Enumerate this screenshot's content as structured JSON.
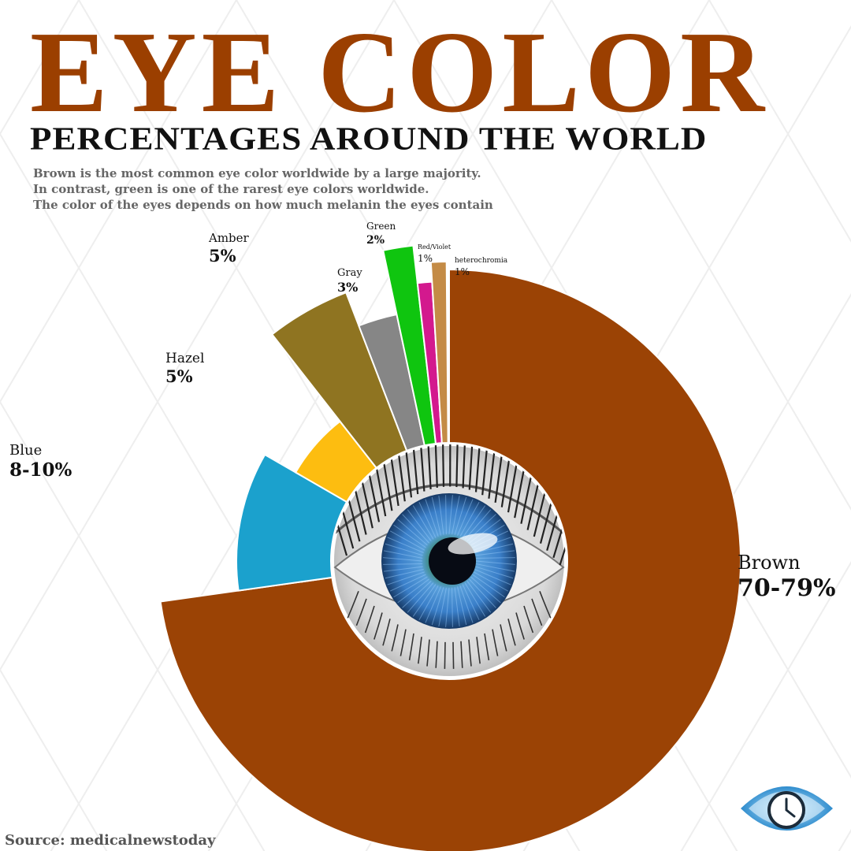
{
  "title": "EYE COLOR",
  "subtitle": "PERCENTAGES AROUND THE WORLD",
  "intro": [
    "Brown is the most common eye color worldwide by a large majority.",
    "In contrast, green is one of the rarest eye colors worldwide.",
    "The color of the eyes depends on how much melanin the eyes contain"
  ],
  "source": "Source: medicalnewstoday",
  "chart_data": {
    "type": "pie",
    "subtype": "polar-area-donut",
    "center_image": "close-up of a blue human eye",
    "slices": [
      {
        "name": "Brown",
        "label": "70-79%",
        "value": 74.5,
        "color": "#9b4305"
      },
      {
        "name": "Blue",
        "label": "8-10%",
        "value": 9,
        "color": "#1ba1cd"
      },
      {
        "name": "Hazel",
        "label": "5%",
        "value": 5,
        "color": "#fdbd10"
      },
      {
        "name": "Amber",
        "label": "5%",
        "value": 5,
        "color": "#8f7421"
      },
      {
        "name": "Gray",
        "label": "3%",
        "value": 3,
        "color": "#868686"
      },
      {
        "name": "Green",
        "label": "2%",
        "value": 2,
        "color": "#0fc50f"
      },
      {
        "name": "Red/Violet",
        "label": "1%",
        "value": 1,
        "color": "#d3198e"
      },
      {
        "name": "heterochromia",
        "label": "1%",
        "value": 1,
        "color": "#c48b46"
      }
    ]
  }
}
